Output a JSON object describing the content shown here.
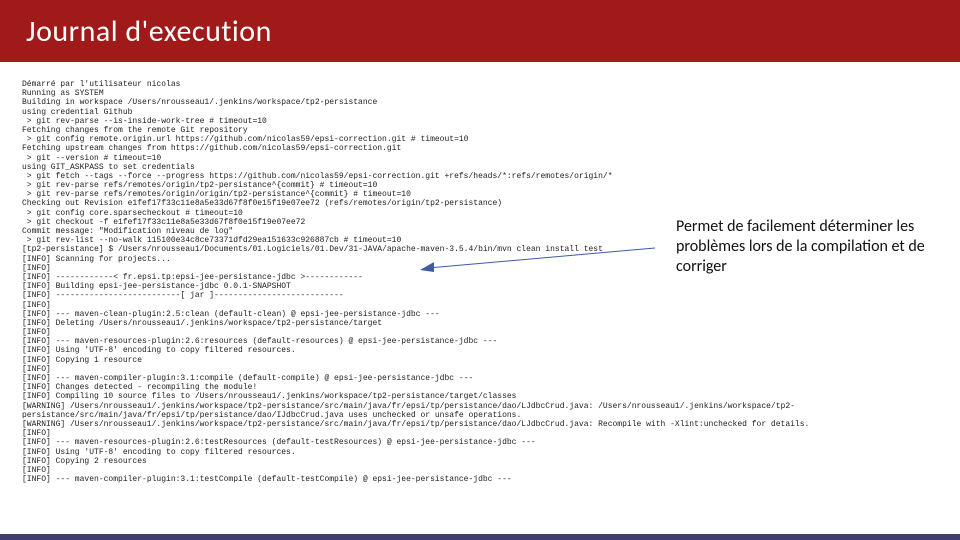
{
  "header": {
    "title": "Journal d'execution"
  },
  "annotation": {
    "text": "Permet de facilement déterminer les problèmes lors de la compilation et de corriger"
  },
  "log": {
    "lines": [
      "Démarré par l'utilisateur nicolas",
      "Running as SYSTEM",
      "Building in workspace /Users/nrousseau1/.jenkins/workspace/tp2-persistance",
      "using credential Github",
      " > git rev-parse --is-inside-work-tree # timeout=10",
      "Fetching changes from the remote Git repository",
      " > git config remote.origin.url https://github.com/nicolas59/epsi-correction.git # timeout=10",
      "Fetching upstream changes from https://github.com/nicolas59/epsi-correction.git",
      " > git --version # timeout=10",
      "using GIT_ASKPASS to set credentials",
      " > git fetch --tags --force --progress https://github.com/nicolas59/epsi-correction.git +refs/heads/*:refs/remotes/origin/*",
      " > git rev-parse refs/remotes/origin/tp2-persistance^{commit} # timeout=10",
      " > git rev-parse refs/remotes/origin/origin/tp2-persistance^{commit} # timeout=10",
      "Checking out Revision e1fef17f33c11e8a5e33d67f8f0e15f19e07ee72 (refs/remotes/origin/tp2-persistance)",
      " > git config core.sparsecheckout # timeout=10",
      " > git checkout -f e1fef17f33c11e8a5e33d67f8f0e15f19e07ee72",
      "Commit message: \"Modification niveau de log\"",
      " > git rev-list --no-walk 115100e34c8ce73371dfd29ea151633c926887cb # timeout=10",
      "[tp2-persistance] $ /Users/nrousseau1/Documents/01.Logiciels/01.Dev/31-JAVA/apache-maven-3.5.4/bin/mvn clean install test",
      "[INFO] Scanning for projects...",
      "[INFO]",
      "[INFO] ------------< fr.epsi.tp:epsi-jee-persistance-jdbc >------------",
      "[INFO] Building epsi-jee-persistance-jdbc 0.0.1-SNAPSHOT",
      "[INFO] --------------------------[ jar ]---------------------------",
      "[INFO]",
      "[INFO] --- maven-clean-plugin:2.5:clean (default-clean) @ epsi-jee-persistance-jdbc ---",
      "[INFO] Deleting /Users/nrousseau1/.jenkins/workspace/tp2-persistance/target",
      "[INFO]",
      "[INFO] --- maven-resources-plugin:2.6:resources (default-resources) @ epsi-jee-persistance-jdbc ---",
      "[INFO] Using 'UTF-8' encoding to copy filtered resources.",
      "[INFO] Copying 1 resource",
      "[INFO]",
      "[INFO] --- maven-compiler-plugin:3.1:compile (default-compile) @ epsi-jee-persistance-jdbc ---",
      "[INFO] Changes detected - recompiling the module!",
      "[INFO] Compiling 10 source files to /Users/nrousseau1/.jenkins/workspace/tp2-persistance/target/classes",
      "[WARNING] /Users/nrousseau1/.jenkins/workspace/tp2-persistance/src/main/java/fr/epsi/tp/persistance/dao/LJdbcCrud.java: /Users/nrousseau1/.jenkins/workspace/tp2-",
      "persistance/src/main/java/fr/epsi/tp/persistance/dao/IJdbcCrud.java uses unchecked or unsafe operations.",
      "[WARNING] /Users/nrousseau1/.jenkins/workspace/tp2-persistance/src/main/java/fr/epsi/tp/persistance/dao/LJdbcCrud.java: Recompile with -Xlint:unchecked for details.",
      "[INFO]",
      "[INFO] --- maven-resources-plugin:2.6:testResources (default-testResources) @ epsi-jee-persistance-jdbc ---",
      "[INFO] Using 'UTF-8' encoding to copy filtered resources.",
      "[INFO] Copying 2 resources",
      "[INFO]",
      "[INFO] --- maven-compiler-plugin:3.1:testCompile (default-testCompile) @ epsi-jee-persistance-jdbc ---"
    ]
  }
}
